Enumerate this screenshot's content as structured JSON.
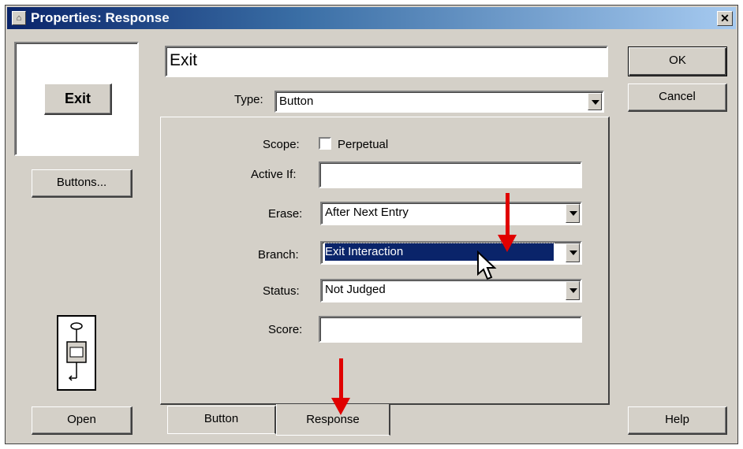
{
  "window": {
    "title": "Properties: Response"
  },
  "preview": {
    "button_label": "Exit"
  },
  "left": {
    "buttons_label": "Buttons...",
    "open_label": "Open"
  },
  "right": {
    "ok_label": "OK",
    "cancel_label": "Cancel",
    "help_label": "Help"
  },
  "name_field": {
    "value": "Exit"
  },
  "type": {
    "label": "Type:",
    "value": "Button"
  },
  "form": {
    "scope_label": "Scope:",
    "perpetual_label": "Perpetual",
    "active_if_label": "Active If:",
    "active_if_value": "",
    "erase_label": "Erase:",
    "erase_value": "After Next Entry",
    "branch_label": "Branch:",
    "branch_value": "Exit Interaction",
    "status_label": "Status:",
    "status_value": "Not Judged",
    "score_label": "Score:",
    "score_value": ""
  },
  "tabs": [
    {
      "label": "Button"
    },
    {
      "label": "Response"
    }
  ],
  "colors": {
    "title_bar": "#0a246a",
    "selection": "#0a246a",
    "annotation_arrow": "#e00000",
    "face": "#d4d0c8"
  }
}
